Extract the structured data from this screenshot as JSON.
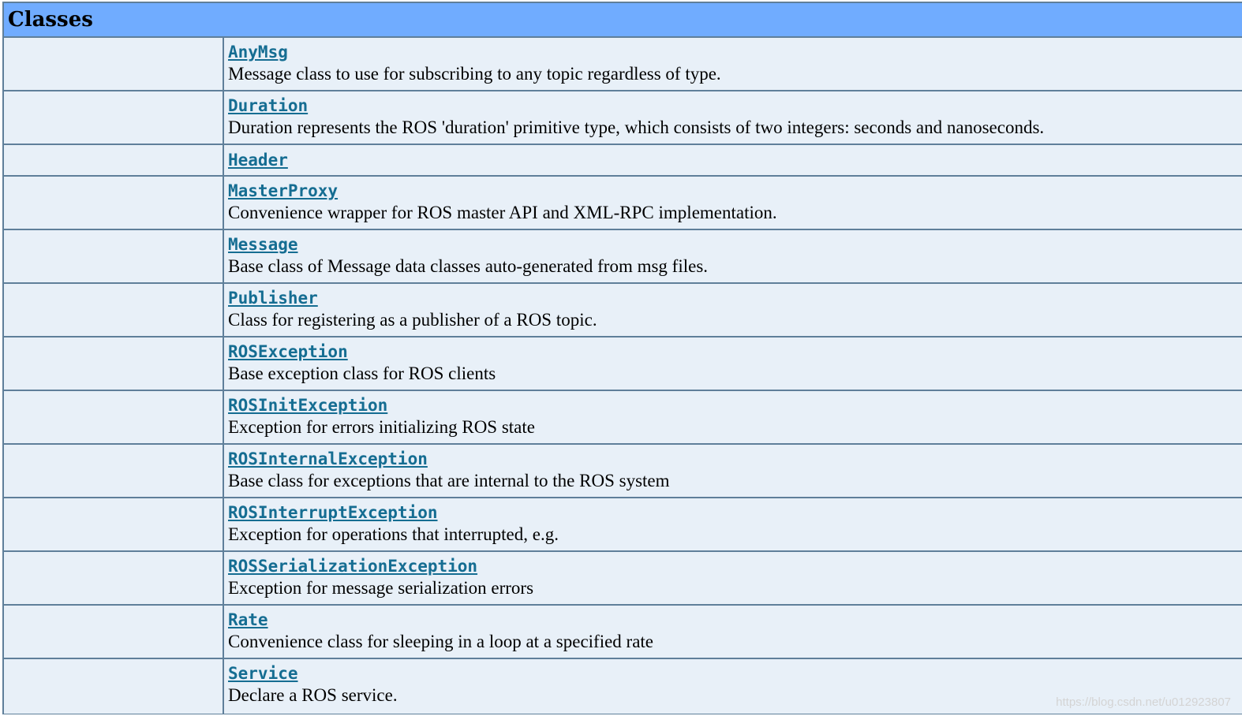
{
  "section": {
    "title": "Classes"
  },
  "classes": [
    {
      "name": "AnyMsg",
      "desc": "Message class to use for subscribing to any topic regardless of type."
    },
    {
      "name": "Duration",
      "desc": "Duration represents the ROS 'duration' primitive type, which consists of two integers: seconds and nanoseconds."
    },
    {
      "name": "Header",
      "desc": ""
    },
    {
      "name": "MasterProxy",
      "desc": "Convenience wrapper for ROS master API and XML-RPC implementation."
    },
    {
      "name": "Message",
      "desc": "Base class of Message data classes auto-generated from msg files."
    },
    {
      "name": "Publisher",
      "desc": "Class for registering as a publisher of a ROS topic."
    },
    {
      "name": "ROSException",
      "desc": "Base exception class for ROS clients"
    },
    {
      "name": "ROSInitException",
      "desc": "Exception for errors initializing ROS state"
    },
    {
      "name": "ROSInternalException",
      "desc": "Base class for exceptions that are internal to the ROS system"
    },
    {
      "name": "ROSInterruptException",
      "desc": "Exception for operations that interrupted, e.g."
    },
    {
      "name": "ROSSerializationException",
      "desc": "Exception for message serialization errors"
    },
    {
      "name": "Rate",
      "desc": "Convenience class for sleeping in a loop at a specified rate"
    },
    {
      "name": "Service",
      "desc": "Declare a ROS service."
    }
  ],
  "watermark": "https://blog.csdn.net/u012923807",
  "colors": {
    "header_bg": "#70acff",
    "row_bg": "#e8f0f8",
    "link": "#156d92",
    "border": "#5f7f9a"
  }
}
